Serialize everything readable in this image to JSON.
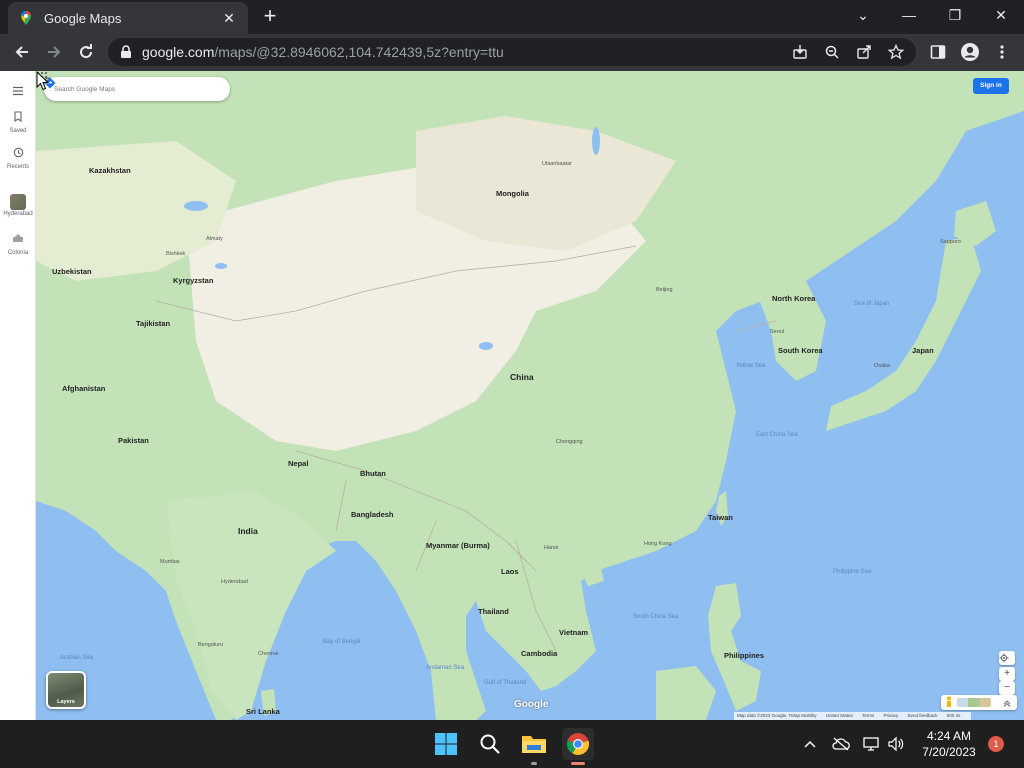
{
  "browser": {
    "tab_title": "Google Maps",
    "tab_close": "✕",
    "new_tab": "+",
    "window": {
      "minimize": "—",
      "restore": "❐",
      "close": "✕",
      "tab_search": "⌄"
    },
    "url_host": "google.com",
    "url_path": "/maps/@32.8946062,104.742439,5z?entry=ttu"
  },
  "maps": {
    "search_placeholder": "Search Google Maps",
    "sign_in": "Sign in",
    "layers_label": "Layers",
    "rail": [
      {
        "label": "Saved"
      },
      {
        "label": "Recents"
      },
      {
        "label": "Hyderabad"
      },
      {
        "label": "Colonia"
      }
    ],
    "labels": {
      "mongolia": "Mongolia",
      "china": "China",
      "kazakhstan": "Kazakhstan",
      "uzbekistan": "Uzbekistan",
      "kyrgyzstan": "Kyrgyzstan",
      "tajikistan": "Tajikistan",
      "afghanistan": "Afghanistan",
      "pakistan": "Pakistan",
      "india": "India",
      "nepal": "Nepal",
      "bhutan": "Bhutan",
      "bangladesh": "Bangladesh",
      "myanmar": "Myanmar\n(Burma)",
      "laos": "Laos",
      "thailand": "Thailand",
      "vietnam": "Vietnam",
      "cambodia": "Cambodia",
      "north_korea": "North Korea",
      "south_korea": "South Korea",
      "japan": "Japan",
      "taiwan": "Taiwan",
      "philippines": "Philippines",
      "sri_lanka": "Sri Lanka",
      "beijing": "Beijing",
      "chongqing": "Chongqing",
      "hong_kong": "Hong Kong",
      "hanoi": "Hanoi",
      "hyderabad": "Hyderabad",
      "mumbai": "Mumbai",
      "bengaluru": "Bengaluru",
      "chennai": "Chennai",
      "ulaanbaatar": "Ulaanbaatar",
      "almaty": "Almaty",
      "bishkek": "Bishkek",
      "osaka": "Osaka",
      "sapporo": "Sapporo",
      "seoul": "Seoul",
      "bay_of_bengal": "Bay of Bengal",
      "arabian_sea": "Arabian Sea",
      "east_china_sea": "East China Sea",
      "south_china_sea": "South China Sea",
      "sea_of_japan": "Sea of Japan",
      "philippine_sea": "Philippine Sea",
      "andaman_sea": "Andaman Sea",
      "gulf_of_thailand": "Gulf of\nThailand",
      "yellow_sea": "Yellow Sea"
    },
    "google_logo": "Google",
    "attribution": [
      "Map data ©2023 Google, TMap Mobility",
      "United States",
      "Terms",
      "Privacy",
      "Send feedback",
      "500 mi"
    ],
    "zoom_in": "+",
    "zoom_out": "−"
  },
  "taskbar": {
    "time": "4:24 AM",
    "date": "7/20/2023",
    "notifications": "1"
  },
  "colors": {
    "chrome_dark": "#202124",
    "chrome_toolbar": "#35363a",
    "water": "#8fbff0",
    "land_green": "#b7dcb0",
    "land_pale": "#f2efe5",
    "accent_blue": "#1a73e8"
  }
}
